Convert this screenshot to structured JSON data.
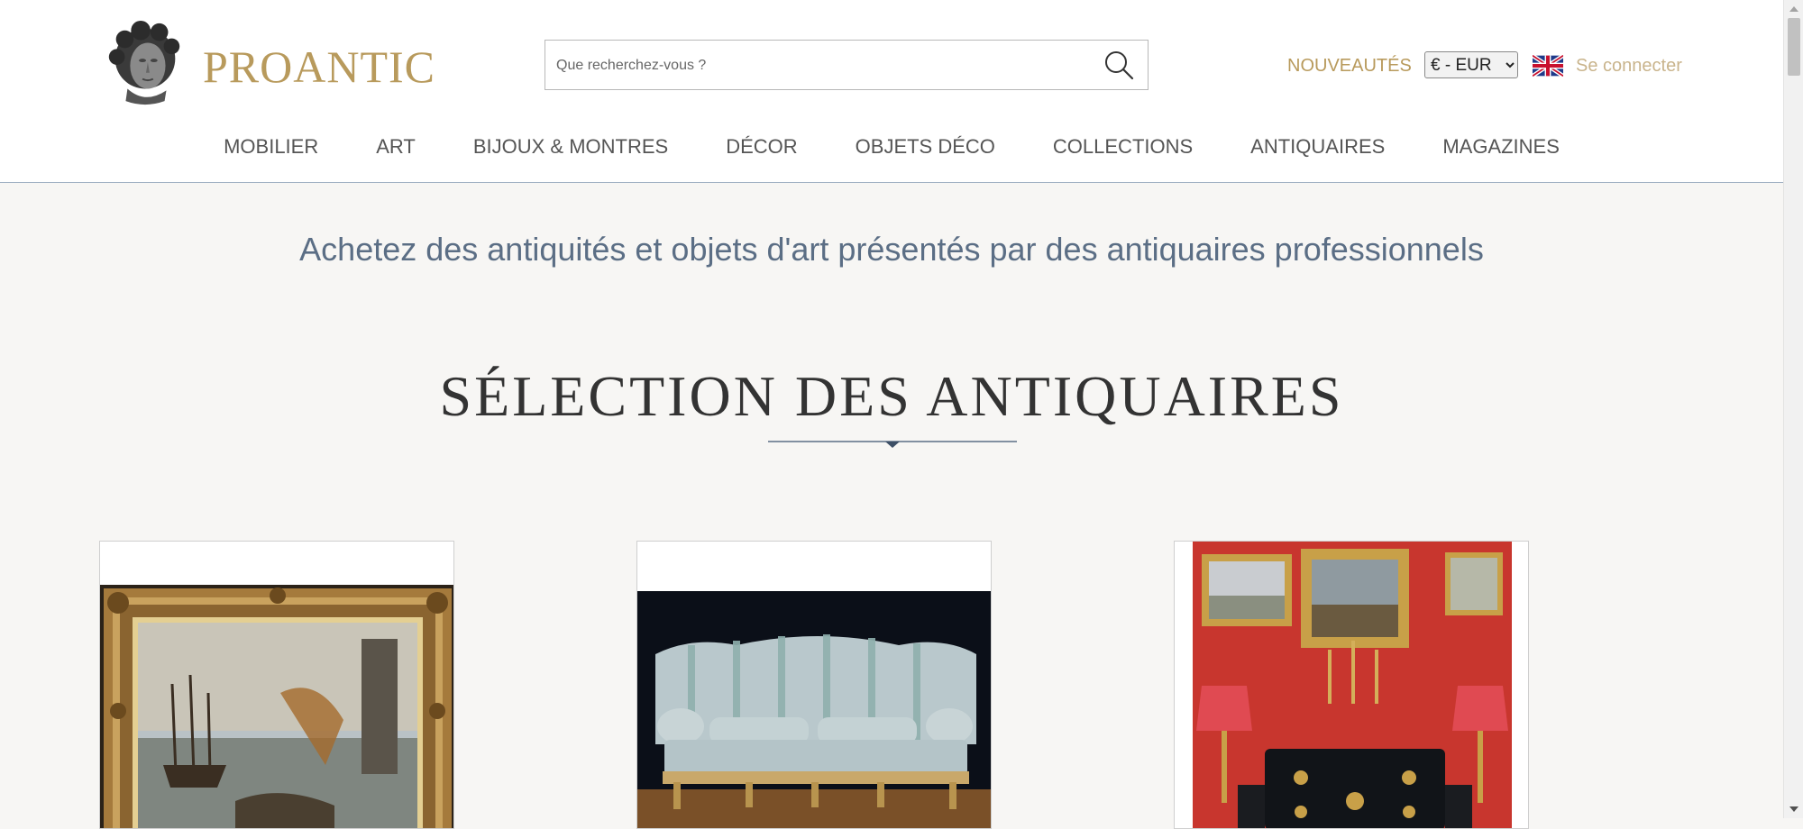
{
  "brand": {
    "name": "PROANTIC",
    "logo_icon": "statue-head-logo-icon"
  },
  "search": {
    "placeholder": "Que recherchez-vous ?",
    "icon": "search-icon"
  },
  "header_links": {
    "new_label": "NOUVEAUTÉS",
    "currency_selected": "€ - EUR",
    "language_flag": "uk-flag-icon",
    "login_label": "Se connecter"
  },
  "nav": {
    "items": [
      {
        "label": "MOBILIER"
      },
      {
        "label": "ART"
      },
      {
        "label": "BIJOUX & MONTRES"
      },
      {
        "label": "DÉCOR"
      },
      {
        "label": "OBJETS DÉCO"
      },
      {
        "label": "COLLECTIONS"
      },
      {
        "label": "ANTIQUAIRES"
      },
      {
        "label": "MAGAZINES"
      }
    ]
  },
  "main": {
    "tagline": "Achetez des antiquités et objets d'art présentés par des antiquaires professionnels",
    "section_title": "SÉLECTION DES ANTIQUAIRES"
  },
  "cards": [
    {
      "subject": "framed-marine-painting"
    },
    {
      "subject": "striped-sofa"
    },
    {
      "subject": "red-room-with-commode-and-paintings"
    }
  ],
  "colors": {
    "brand_gold": "#b89a5c",
    "nav_text": "#555555",
    "tagline_blue": "#5b6e85",
    "page_bg": "#f7f6f4",
    "header_border": "#9fb0c2"
  }
}
